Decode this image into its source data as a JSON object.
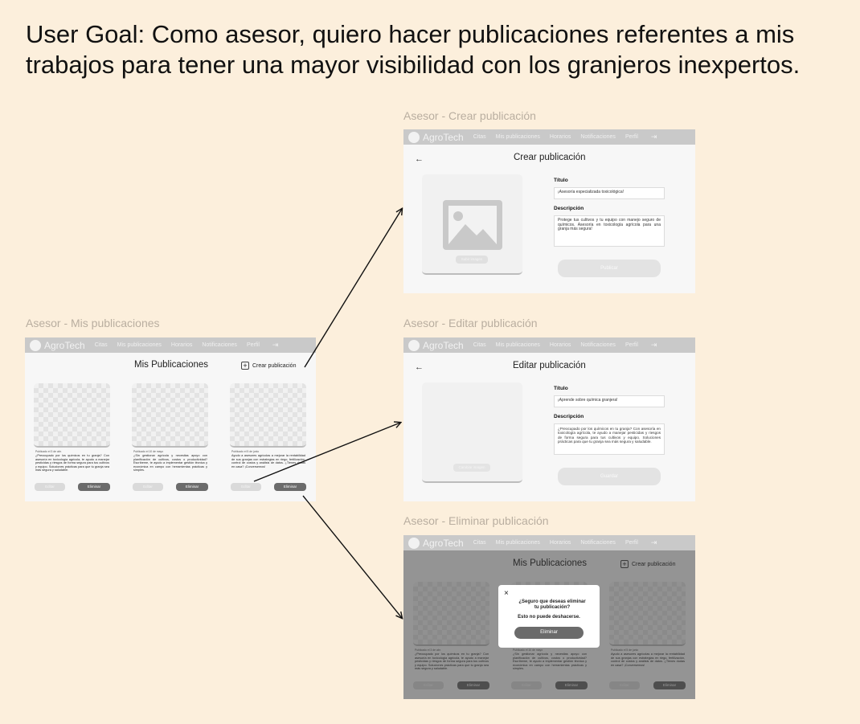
{
  "user_goal": "User Goal: Como asesor, quiero hacer publicaciones referentes a mis trabajos para tener una mayor visibilidad con los granjeros inexpertos.",
  "nav": {
    "brand": "AgroTech",
    "items": [
      "Citas",
      "Mis publicaciones",
      "Horarios",
      "Notificaciones",
      "Perfil"
    ],
    "logout_icon": "logout-icon"
  },
  "frames": {
    "mis_publicaciones": {
      "label": "Asesor - Mis publicaciones",
      "title": "Mis Publicaciones",
      "create_label": "Crear publicación",
      "cards": [
        {
          "date": "Publicado el 3 de abr.",
          "description": "¿Preocupado por los químicos en tu granja? Con asesoría en toxicología agrícola, te ayudo a manejar pesticidas y riesgos de forma segura para tus cultivos y equipo. Soluciones prácticas para que tu granja sea más segura y saludable.",
          "edit_label": "Editar",
          "delete_label": "Eliminar"
        },
        {
          "date": "Publicado el 10 de mayo",
          "description": "¿Sin gestionar agrícola y necesitas apoyo con planificación de cultivos, costos o productividad? Escríbeme, te ayudo a implementar gestión técnica y económica en campo con herramientas prácticas y simples.",
          "edit_label": "Editar",
          "delete_label": "Eliminar"
        },
        {
          "date": "Publicado el 5 de junio",
          "description": "Ayudo a asesores agrícolas a mejorar la rentabilidad de sus granjas con estrategias en riego, fertilización, control de costos y análisis de datos. ¿Tienes dudas en casa? ¡Conversemos!",
          "edit_label": "Editar",
          "delete_label": "Eliminar"
        }
      ]
    },
    "crear": {
      "label": "Asesor - Crear publicación",
      "title": "Crear publicación",
      "image_button": "Subir imagen",
      "title_label": "Título",
      "title_value": "¡Asesoría especializada toxicológica!",
      "desc_label": "Descripción",
      "desc_value": "Protege tus cultivos y tu equipo con manejo seguro de químicos. Asesoría en toxicología agrícola para una granja más segura!",
      "submit": "Publicar"
    },
    "editar": {
      "label": "Asesor - Editar publicación",
      "title": "Editar publicación",
      "image_button": "Cambiar imagen",
      "title_label": "Título",
      "title_value": "¡Aprende sobre química granjera!",
      "desc_label": "Descripción",
      "desc_value": "¿Preocupado por los químicos en tu granja? Con asesoría en toxicología agrícola, te ayudo a manejar pesticidas y riesgos de forma segura para tus cultivos y equipo. Soluciones prácticas para que tu granja sea más segura y saludable.",
      "submit": "Guardar"
    },
    "eliminar": {
      "label": "Asesor - Eliminar publicación",
      "modal_question": "¿Seguro que deseas eliminar tu publicación?",
      "modal_warning": "Esto no puede deshacerse.",
      "modal_button": "Eliminar",
      "close_icon": "×"
    }
  }
}
